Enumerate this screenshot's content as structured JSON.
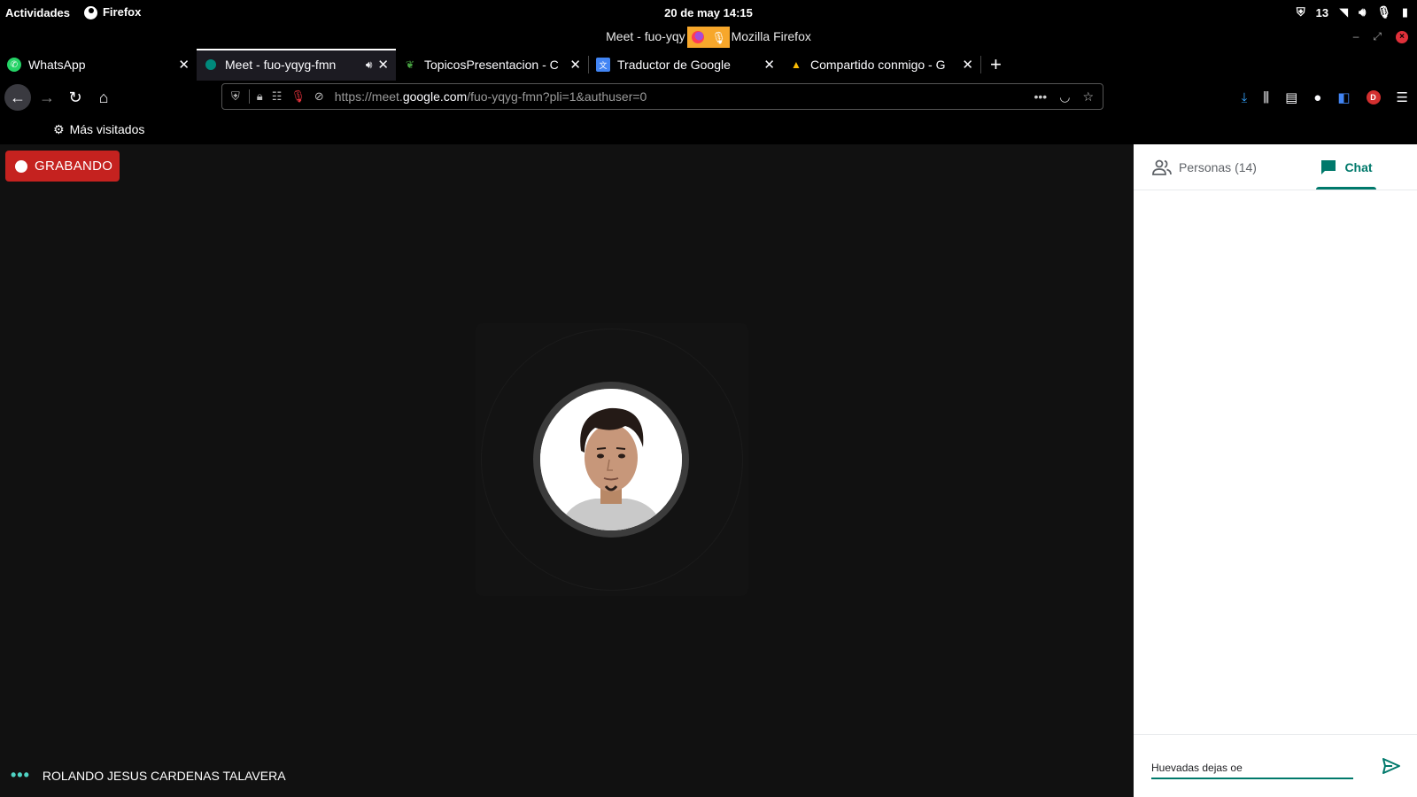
{
  "system_bar": {
    "activities": "Actividades",
    "app_name": "Firefox",
    "datetime": "20 de may  14:15",
    "notif_count": "13"
  },
  "window": {
    "title_left": "Meet - fuo-yqy",
    "title_right": "Mozilla Firefox"
  },
  "tabs": [
    {
      "label": "WhatsApp",
      "icon": "whatsapp-icon"
    },
    {
      "label": "Meet - fuo-yqyg-fmn",
      "icon": "meet-icon"
    },
    {
      "label": "TopicosPresentacion - C",
      "icon": "overleaf-icon"
    },
    {
      "label": "Traductor de Google",
      "icon": "translate-icon"
    },
    {
      "label": "Compartido conmigo - G",
      "icon": "drive-icon"
    }
  ],
  "urlbar": {
    "url_prefix": "https://meet.",
    "url_domain": "google.com",
    "url_path": "/fuo-yqyg-fmn?pli=1&authuser=0"
  },
  "bookmarks": {
    "most_visited": "Más visitados"
  },
  "meet": {
    "recording_label": "GRABANDO",
    "participant_name": "ROLANDO JESUS CARDENAS TALAVERA"
  },
  "panel": {
    "people_label": "Personas (14)",
    "chat_label": "Chat",
    "chat_input_value": "Huevadas dejas oe"
  },
  "colors": {
    "accent": "#00796b",
    "recording": "#c5221f",
    "meet_bg": "#111111"
  }
}
